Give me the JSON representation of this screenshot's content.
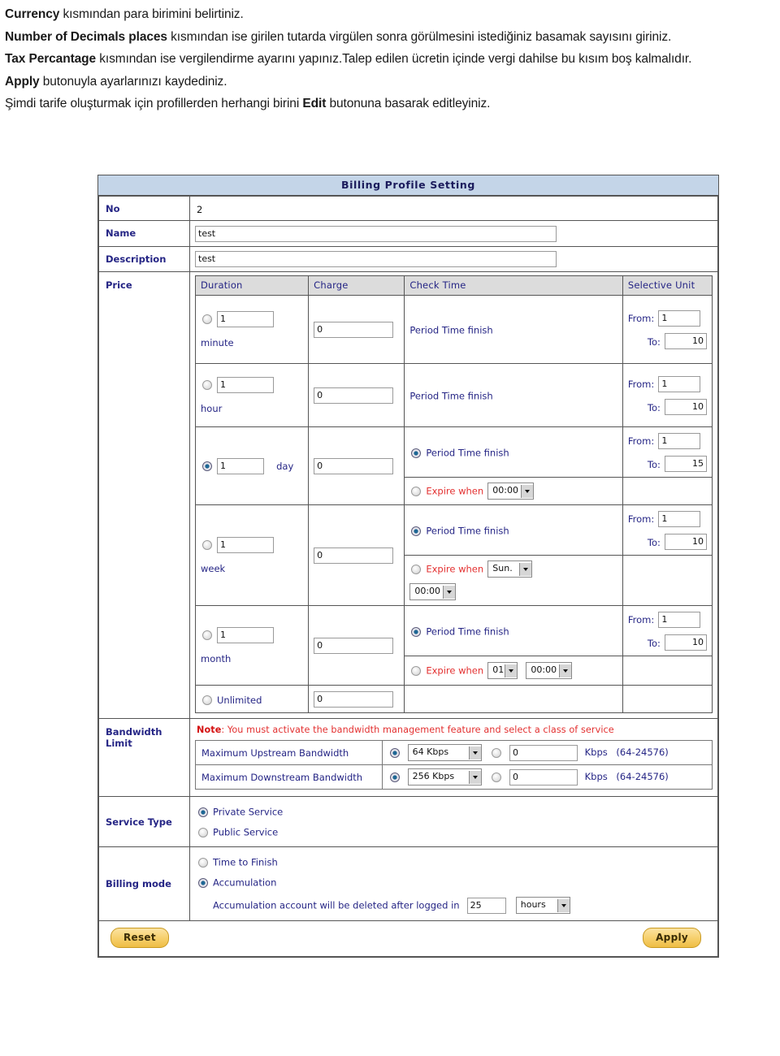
{
  "document": {
    "lines": [
      [
        {
          "t": "Currency",
          "b": true
        },
        {
          "t": " kısmından para birimini belirtiniz.",
          "b": false
        }
      ],
      [
        {
          "t": "Number of Decimals places",
          "b": true
        },
        {
          "t": " kısmından ise girilen tutarda virgülen sonra görülmesini istediğiniz basamak sayısını giriniz.",
          "b": false
        }
      ],
      [
        {
          "t": "Tax Percantage",
          "b": true
        },
        {
          "t": " kısmından ise vergilendirme ayarını yapınız.Talep edilen ücretin içinde vergi dahilse bu kısım boş kalmalıdır.",
          "b": false
        }
      ],
      [
        {
          "t": "Apply",
          "b": true
        },
        {
          "t": " butonuyla ayarlarınızı kaydediniz.",
          "b": false
        }
      ],
      [
        {
          "t": "Şimdi tarife oluşturmak için profillerden herhangi birini ",
          "b": false
        },
        {
          "t": "Edit",
          "b": true
        },
        {
          "t": " butonuna basarak editleyiniz.",
          "b": false
        }
      ]
    ]
  },
  "panel": {
    "title": "Billing Profile Setting",
    "fields": {
      "no_label": "No",
      "no_value": "2",
      "name_label": "Name",
      "name_value": "test",
      "description_label": "Description",
      "description_value": "test",
      "price_label": "Price",
      "bandwidth_label_line1": "Bandwidth",
      "bandwidth_label_line2": "Limit",
      "service_type_label": "Service Type",
      "billing_mode_label": "Billing mode"
    },
    "price_table": {
      "headers": [
        "Duration",
        "Charge",
        "Check Time",
        "Selective Unit"
      ],
      "from_label": "From:",
      "to_label": "To:",
      "period_label": "Period Time finish",
      "expire_label": "Expire when",
      "unlimited_label": "Unlimited",
      "rows": [
        {
          "unit": "minute",
          "duration_value": "1",
          "duration_selected": false,
          "charge": "0",
          "check_plain": "Period Time finish",
          "from": "1",
          "to": "10"
        },
        {
          "unit": "hour",
          "duration_value": "1",
          "duration_selected": false,
          "charge": "0",
          "check_plain": "Period Time finish",
          "from": "1",
          "to": "10"
        },
        {
          "unit": "day",
          "duration_value": "1",
          "duration_selected": true,
          "charge": "0",
          "period_selected": true,
          "expire_selected": false,
          "expire_time": "00:00",
          "from": "1",
          "to": "15"
        },
        {
          "unit": "week",
          "duration_value": "1",
          "duration_selected": false,
          "charge": "0",
          "period_selected": true,
          "expire_selected": false,
          "expire_day": "Sun.",
          "expire_time": "00:00",
          "from": "1",
          "to": "10"
        },
        {
          "unit": "month",
          "duration_value": "1",
          "duration_selected": false,
          "charge": "0",
          "period_selected": true,
          "expire_selected": false,
          "expire_month": "01",
          "expire_time": "00:00",
          "from": "1",
          "to": "10"
        },
        {
          "unit": "Unlimited",
          "duration_selected": false,
          "charge": "0"
        }
      ]
    },
    "bandwidth": {
      "note_prefix": "Note",
      "note_text": ": You must activate the bandwidth management feature and select a class of service",
      "upstream_label": "Maximum Upstream Bandwidth",
      "upstream_preset": "64 Kbps",
      "upstream_preset_selected": true,
      "upstream_custom": "0",
      "upstream_custom_selected": false,
      "downstream_label": "Maximum Downstream Bandwidth",
      "downstream_preset": "256 Kbps",
      "downstream_preset_selected": true,
      "downstream_custom": "0",
      "downstream_custom_selected": false,
      "kbps_unit": "Kbps",
      "range_hint": "(64-24576)"
    },
    "service_type": {
      "options": [
        {
          "label": "Private Service",
          "selected": true
        },
        {
          "label": "Public Service",
          "selected": false
        }
      ]
    },
    "billing_mode": {
      "options": [
        {
          "label": "Time to Finish",
          "selected": false
        },
        {
          "label": "Accumulation",
          "selected": true
        }
      ],
      "accumulation_text": "Accumulation account will be deleted after logged in",
      "accumulation_value": "25",
      "accumulation_unit": "hours"
    },
    "buttons": {
      "reset": "Reset",
      "apply": "Apply"
    }
  },
  "colors": {
    "title_band": "#c4d5e8",
    "label_navy": "#252585",
    "warning_red": "#e33030",
    "button_amber": "#f6cf6a",
    "header_gray": "#dcdcdc"
  }
}
